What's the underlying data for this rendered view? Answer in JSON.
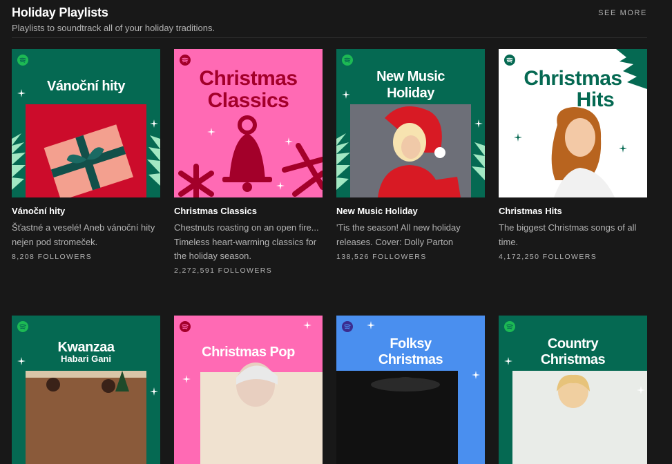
{
  "shelf": {
    "title": "Holiday Playlists",
    "subtitle": "Playlists to soundtrack all of your holiday traditions.",
    "see_more": "SEE MORE"
  },
  "colors": {
    "background": "#181818",
    "spotify_green": "#1db954",
    "deep_green": "#056952",
    "pink": "#ff6ab4",
    "blue": "#4a8fef",
    "mint": "#a2e8c3",
    "dark_red": "#a3002a"
  },
  "cards": [
    {
      "title": "Vánoční hity",
      "cover_text": "Vánoční hity",
      "description": "Šťastné a veselé! Aneb vánoční hity nejen pod stromeček.",
      "followers": "8,208 FOLLOWERS"
    },
    {
      "title": "Christmas Classics",
      "cover_text_line1": "Christmas",
      "cover_text_line2": "Classics",
      "description": "Chestnuts roasting on an open fire... Timeless heart-warming classics for the holiday season.",
      "followers": "2,272,591 FOLLOWERS"
    },
    {
      "title": "New Music Holiday",
      "cover_text_line1": "New Music",
      "cover_text_line2": "Holiday",
      "description": "'Tis the season! All new holiday releases. Cover: Dolly Parton",
      "followers": "138,526 FOLLOWERS"
    },
    {
      "title": "Christmas Hits",
      "cover_text_line1": "Christmas",
      "cover_text_line2": "Hits",
      "description": "The biggest Christmas songs of all time.",
      "followers": "4,172,250 FOLLOWERS"
    },
    {
      "cover_text_line1": "Kwanzaa",
      "cover_text_line2": "Habari Gani"
    },
    {
      "cover_text": "Christmas Pop"
    },
    {
      "cover_text_line1": "Folksy",
      "cover_text_line2": "Christmas"
    },
    {
      "cover_text_line1": "Country",
      "cover_text_line2": "Christmas"
    }
  ]
}
